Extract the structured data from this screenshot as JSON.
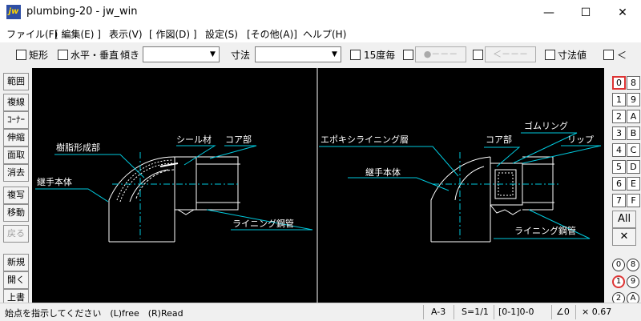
{
  "window": {
    "title": "plumbing-20 - jw_win",
    "icon_text": "jw",
    "minimize_icon": "minimize-icon",
    "maximize_icon": "maximize-icon",
    "close_icon": "close-icon",
    "minimize_glyph": "—",
    "maximize_glyph": "☐",
    "close_glyph": "✕"
  },
  "menu": [
    "ファイル(F)",
    "[ 編集(E) ]",
    "表示(V)",
    "[ 作図(D) ]",
    "設定(S)",
    "[その他(A)]",
    "ヘルプ(H)"
  ],
  "toolbar": {
    "rect_label": "矩形",
    "hv_label": "水平・垂直",
    "tilt_label": "傾き",
    "tilt_value": "",
    "dim_label": "寸法",
    "dim_value": "",
    "deg15_label": "15度毎",
    "dot_button": "●－－－",
    "arrow_button": "＜－－－",
    "dimval_label": "寸法値",
    "lt_label": "＜"
  },
  "left_tools": [
    "範囲",
    "複線",
    "ｺｰﾅｰ",
    "伸縮",
    "面取",
    "消去",
    "複写",
    "移動",
    "戻る",
    "新規",
    "開く",
    "上書"
  ],
  "right_tools": {
    "layers_left": [
      "0",
      "1",
      "2",
      "3",
      "4",
      "5",
      "6",
      "7"
    ],
    "layers_right": [
      "8",
      "9",
      "A",
      "B",
      "C",
      "D",
      "E",
      "F"
    ],
    "selected_layer": "0",
    "all_label": "All",
    "cross_label": "✕",
    "groups_left": [
      "0",
      "1",
      "2"
    ],
    "groups_right": [
      "8",
      "9",
      "A"
    ],
    "selected_group": "1"
  },
  "drawing": {
    "left": {
      "resin": "樹脂形成部",
      "seal": "シール材",
      "core": "コア部",
      "body": "継手本体",
      "pipe": "ライニング鋼管"
    },
    "right": {
      "epoxy": "エポキシライニング層",
      "rubber": "ゴムリング",
      "core": "コア部",
      "lip": "リップ",
      "body": "継手本体",
      "pipe": "ライニング鋼管"
    }
  },
  "status": {
    "message": "始点を指示してください　(L)free　(R)Read",
    "paper": "A-3",
    "scale": "S=1/1",
    "layer": "[0-1]0-0",
    "angle": "∠0",
    "zoom": "× 0.67"
  },
  "colors": {
    "canvas": "#000000",
    "lines": "#ffffff",
    "leaders": "#00c8dc",
    "selected": "#dd3333"
  }
}
